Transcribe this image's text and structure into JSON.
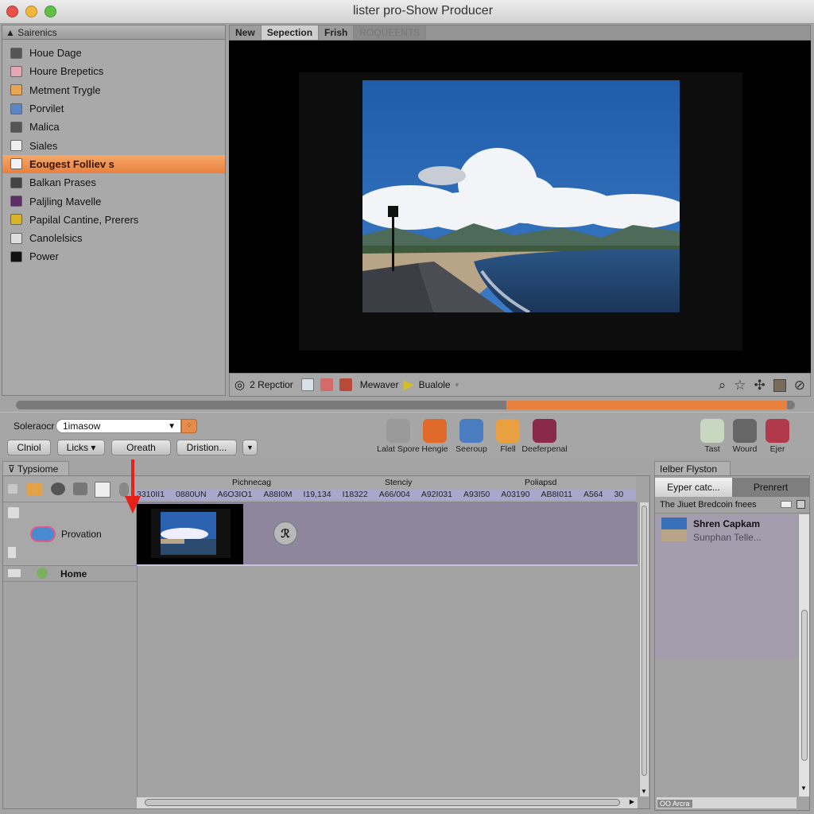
{
  "window": {
    "title": "lister pro-Show Producer",
    "traffic_lights": [
      {
        "name": "close",
        "color": "#e8514a"
      },
      {
        "name": "minimize",
        "color": "#f4b73b"
      },
      {
        "name": "zoom",
        "color": "#5fc246"
      }
    ]
  },
  "sidebar": {
    "header": "Sairenics",
    "items": [
      {
        "label": "Houe Dage",
        "icon": "calendar-icon",
        "color": "#555"
      },
      {
        "label": "Houre Brepetics",
        "icon": "pink-folder-icon",
        "color": "#e5a7b4"
      },
      {
        "label": "Metment Trygle",
        "icon": "orange-folder-icon",
        "color": "#e9a456"
      },
      {
        "label": "Porvilet",
        "icon": "document-folder-icon",
        "color": "#5b85c4"
      },
      {
        "label": "Malica",
        "icon": "puzzle-icon",
        "color": "#555"
      },
      {
        "label": "Siales",
        "icon": "envelope-icon",
        "color": "#eee"
      },
      {
        "label": "Eougest Folliev s",
        "icon": "folder-icon",
        "color": "#f3f3f3",
        "selected": true
      },
      {
        "label": "Balkan Prases",
        "icon": "feather-icon",
        "color": "#444"
      },
      {
        "label": "Paljling Mavelle",
        "icon": "figure-icon",
        "color": "#5b2f63"
      },
      {
        "label": "Papilal Cantine, Prerers",
        "icon": "butterfly-icon",
        "color": "#d7b32a"
      },
      {
        "label": "Canolelsics",
        "icon": "picture-icon",
        "color": "#ddd"
      },
      {
        "label": "Power",
        "icon": "apple-icon",
        "color": "#111"
      }
    ]
  },
  "viewer": {
    "tabs": [
      {
        "label": "New",
        "active": false
      },
      {
        "label": "Sepection",
        "active": true
      },
      {
        "label": "Frish",
        "active": false
      },
      {
        "label": "ROQUEENTS",
        "active": false,
        "dim": true
      }
    ]
  },
  "viewer_toolbar": {
    "counter_label": "2 Repctior",
    "mode_label": "Mewaver",
    "play_label": "Bualole",
    "right_icons": [
      "search-icon",
      "star-icon",
      "move-icon",
      "photo-icon",
      "compass-icon"
    ]
  },
  "scrubber": {
    "start_fraction": 0.63,
    "end_fraction": 0.99,
    "color": "#e8803e"
  },
  "controls": {
    "selector_label": "Soleraocr",
    "selector_value": "1imasow",
    "buttons": [
      "Clniol",
      "Licks ▾",
      "Oreath",
      "Dristion..."
    ],
    "apps": [
      {
        "label": "Lalat Spore",
        "icon": "gear-icon",
        "color": "#9a9a9a"
      },
      {
        "label": "Hengie",
        "icon": "firefox-icon",
        "color": "#e06a2a"
      },
      {
        "label": "Seeroup",
        "icon": "clock-icon",
        "color": "#4a7cc0"
      },
      {
        "label": "Flell",
        "icon": "chrome-icon",
        "color": "#e8a040"
      },
      {
        "label": "Deeferpenal",
        "icon": "music-icon",
        "color": "#8a2a4a"
      }
    ],
    "right_apps": [
      {
        "label": "Tast",
        "icon": "landscape-icon",
        "color": "#c8d8c0"
      },
      {
        "label": "Wourd",
        "icon": "camera-icon",
        "color": "#666"
      },
      {
        "label": "Ejer",
        "icon": "pinwheel-icon",
        "color": "#b03a4a"
      }
    ]
  },
  "timeline": {
    "tab_label": "Typsiome",
    "ruler_labels": [
      "Pichnecag",
      "Stenciy",
      "Poliapsd"
    ],
    "ruler_values": [
      "3310II1",
      "0880UN",
      "A6O3IO1",
      "A88I0M",
      "I19,134",
      "I18322",
      "A66/004",
      "A92I031",
      "A93I50",
      "A03190",
      "AB8I011",
      "A564",
      "30"
    ],
    "tracks": [
      {
        "label": "Provation",
        "icon": "badge-icon"
      },
      {
        "label": "Home",
        "icon": "home-icon"
      }
    ]
  },
  "right_panel": {
    "tab_label": "Ielber Flyston",
    "segments": [
      "Eyper catc...",
      "Prenrert"
    ],
    "subheader": "The Jiuet Bredcoin fnees",
    "items": [
      {
        "title": "Shren Capkam",
        "subtitle": "Sunphan Telle..."
      }
    ],
    "footer_label": "OO Arcra"
  }
}
